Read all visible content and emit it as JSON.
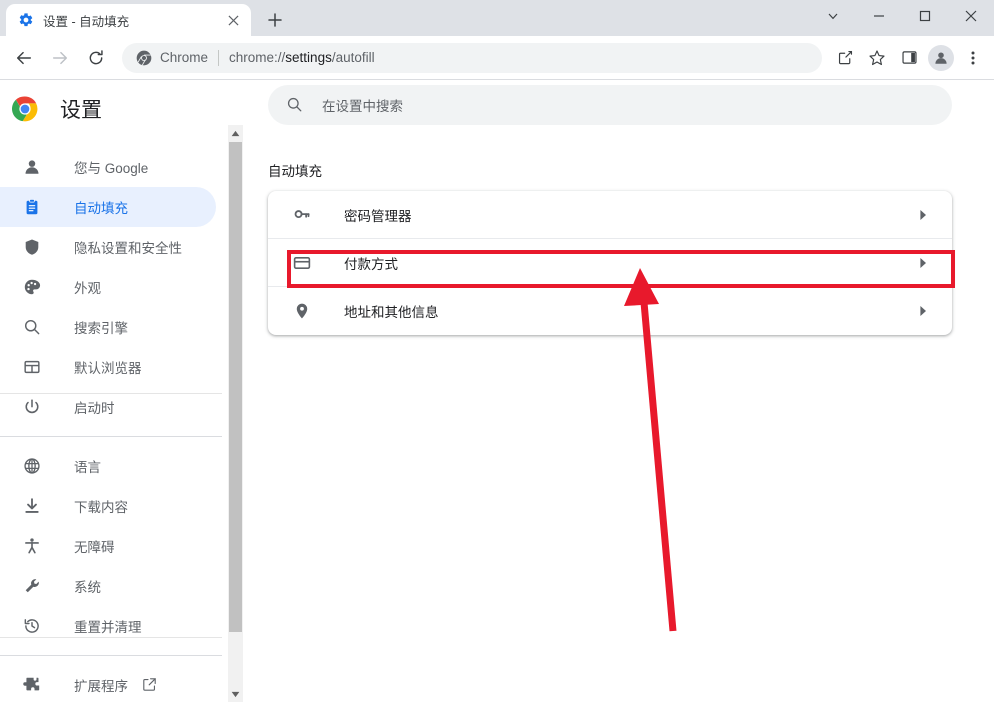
{
  "window": {
    "controls": [
      {
        "name": "tab-search-button",
        "icon": "chevron-down-icon"
      },
      {
        "name": "minimize-button",
        "icon": "minimize-icon"
      },
      {
        "name": "maximize-button",
        "icon": "maximize-icon"
      },
      {
        "name": "close-button",
        "icon": "close-icon"
      }
    ]
  },
  "tab": {
    "title": "设置 - 自动填充",
    "favicon": "gear-icon",
    "close_label": "×",
    "newtab_label": "+"
  },
  "toolbar": {
    "back": "back-arrow-icon",
    "forward": "forward-arrow-icon",
    "reload": "reload-icon",
    "omnibox": {
      "chrome_icon": "chrome-icon",
      "chrome_label": "Chrome",
      "url_prefix": "chrome://",
      "url_bold": "settings",
      "url_suffix": "/autofill",
      "full_url": "chrome://settings/autofill"
    },
    "share_icon": "share-icon",
    "bookmark_icon": "star-icon",
    "sidepanel_icon": "side-panel-icon",
    "profile_icon": "person-icon",
    "menu_icon": "three-dots-icon"
  },
  "sidebar": {
    "brand": {
      "logo": "chrome-logo",
      "title": "设置"
    },
    "groups": [
      {
        "items": [
          {
            "label": "您与 Google",
            "icon": "person-icon",
            "selected": false
          },
          {
            "label": "自动填充",
            "icon": "clipboard-icon",
            "selected": true
          },
          {
            "label": "隐私设置和安全性",
            "icon": "shield-icon",
            "selected": false
          },
          {
            "label": "外观",
            "icon": "palette-icon",
            "selected": false
          },
          {
            "label": "搜索引擎",
            "icon": "search-icon",
            "selected": false
          },
          {
            "label": "默认浏览器",
            "icon": "browser-window-icon",
            "selected": false
          },
          {
            "label": "启动时",
            "icon": "power-icon",
            "selected": false
          }
        ]
      },
      {
        "items": [
          {
            "label": "语言",
            "icon": "globe-icon",
            "selected": false
          },
          {
            "label": "下载内容",
            "icon": "download-icon",
            "selected": false
          },
          {
            "label": "无障碍",
            "icon": "accessibility-icon",
            "selected": false
          },
          {
            "label": "系统",
            "icon": "wrench-icon",
            "selected": false
          },
          {
            "label": "重置并清理",
            "icon": "history-restore-icon",
            "selected": false
          }
        ]
      },
      {
        "items": [
          {
            "label": "扩展程序",
            "icon": "puzzle-icon",
            "selected": false,
            "external": true
          }
        ]
      }
    ]
  },
  "main": {
    "search": {
      "placeholder": "在设置中搜索",
      "value": "",
      "icon": "search-icon"
    },
    "section_title": "自动填充",
    "rows": [
      {
        "label": "密码管理器",
        "icon": "key-icon",
        "arrow": "chevron-right-icon",
        "highlighted": false
      },
      {
        "label": "付款方式",
        "icon": "credit-card-icon",
        "arrow": "chevron-right-icon",
        "highlighted": true
      },
      {
        "label": "地址和其他信息",
        "icon": "location-pin-icon",
        "arrow": "chevron-right-icon",
        "highlighted": false
      }
    ]
  },
  "annotations": {
    "highlight_color": "#e8192c",
    "arrow_color": "#e8192c",
    "target_row_label": "付款方式"
  },
  "colors": {
    "accent": "#1a73e8",
    "selected_bg": "#e8f0fe",
    "tabstrip_bg": "#dee1e6",
    "toolbar_bg": "#ffffff",
    "omnibox_bg": "#f1f3f4",
    "text_primary": "#202124",
    "text_secondary": "#5f6368"
  }
}
